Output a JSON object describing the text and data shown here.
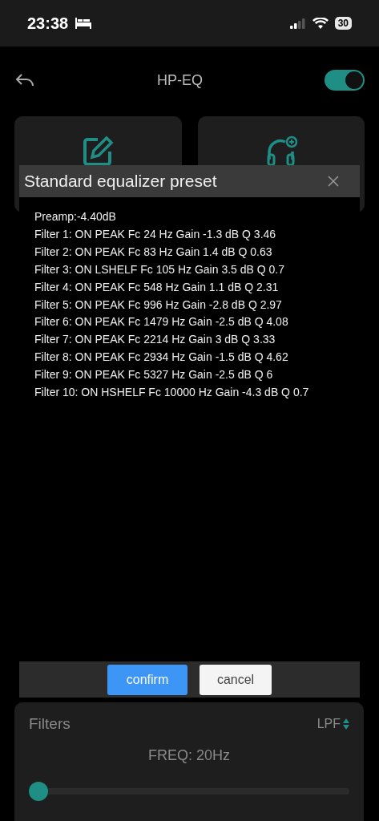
{
  "status_bar": {
    "time": "23:38",
    "battery": "30"
  },
  "header": {
    "title": "HP-EQ",
    "toggle_on": true
  },
  "dialog": {
    "title": "Standard equalizer preset",
    "lines": [
      "Preamp:-4.40dB",
      "Filter 1: ON PEAK Fc 24 Hz Gain -1.3 dB Q 3.46",
      "Filter 2: ON PEAK Fc 83 Hz Gain 1.4 dB Q 0.63",
      "Filter 3: ON LSHELF Fc 105 Hz Gain 3.5 dB Q 0.7",
      "Filter 4: ON PEAK Fc 548 Hz Gain 1.1 dB Q 2.31",
      "Filter 5: ON PEAK Fc 996 Hz Gain -2.8 dB Q 2.97",
      "Filter 6: ON PEAK Fc 1479 Hz Gain -2.5 dB Q 4.08",
      "Filter 7: ON PEAK Fc 2214 Hz Gain 3 dB Q 3.33",
      "Filter 8: ON PEAK Fc 2934 Hz Gain -1.5 dB Q 4.62",
      "Filter 9: ON PEAK Fc 5327 Hz Gain -2.5 dB Q 6",
      "Filter 10: ON HSHELF Fc 10000 Hz Gain -4.3 dB Q 0.7"
    ],
    "buttons": [
      {
        "label": "confirm",
        "kind": "primary"
      },
      {
        "label": "cancel",
        "kind": "secondary"
      }
    ]
  },
  "filters": {
    "title": "Filters",
    "type": "LPF",
    "freq_label": "FREQ: 20Hz",
    "level": 0
  }
}
